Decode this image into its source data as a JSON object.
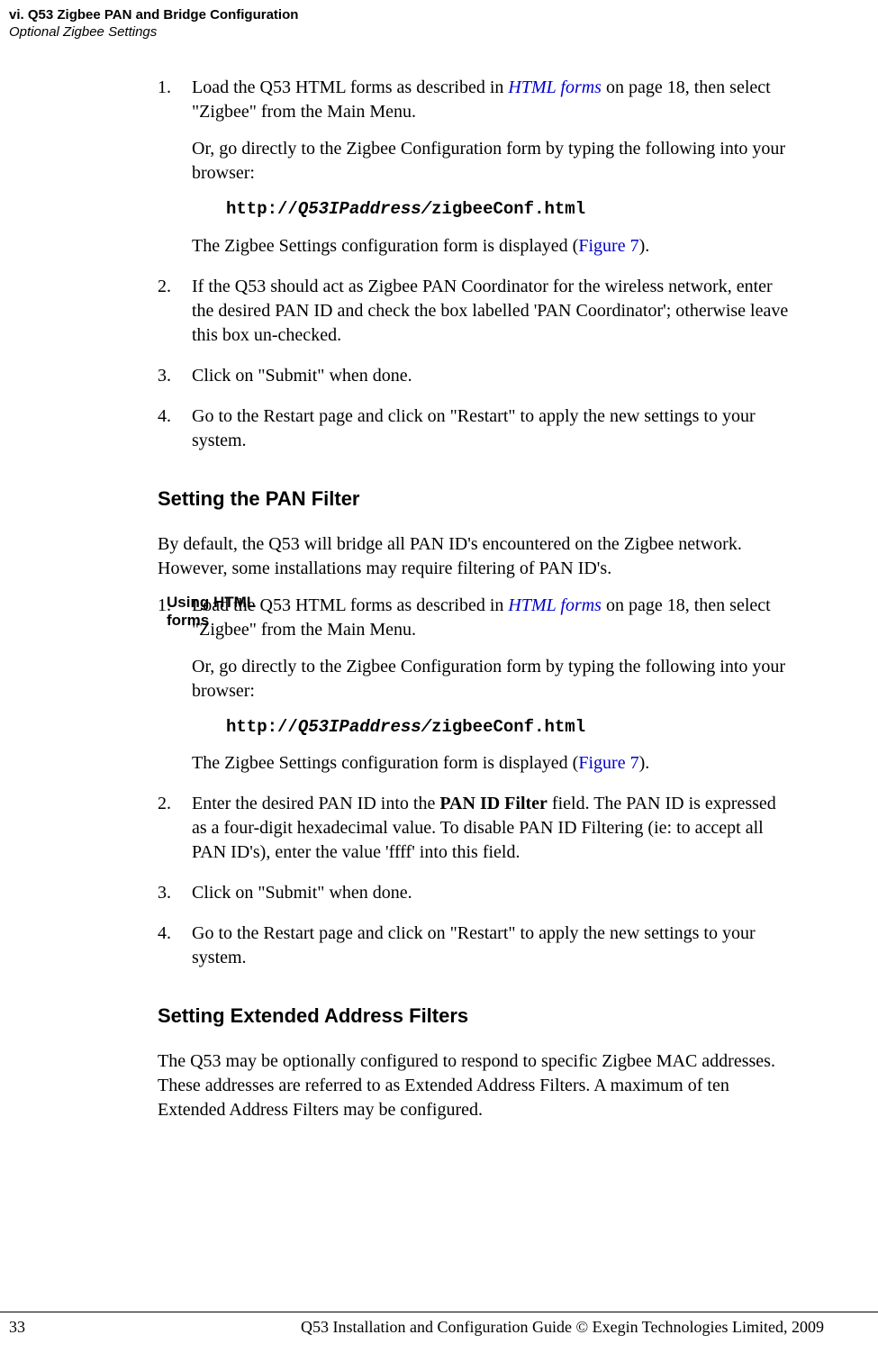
{
  "header": {
    "title": "vi. Q53 Zigbee PAN and Bridge Configuration",
    "subtitle": "Optional Zigbee Settings"
  },
  "block1": {
    "s1a": "Load the Q53 HTML forms as described in ",
    "s1link": "HTML forms",
    "s1b": " on page 18, then select \"Zigbee\" from the Main Menu.",
    "s1p2": "Or, go directly to the Zigbee Configuration form by typing the following into your browser:",
    "code_a": "http://",
    "code_b": "Q53IPaddress/",
    "code_c": "zigbeeConf.html",
    "s1p3a": "The Zigbee Settings configuration form is displayed (",
    "s1p3link": "Figure 7",
    "s1p3b": ").",
    "s2": "If the Q53 should act as Zigbee PAN Coordinator for the wireless network, enter the desired PAN ID and check the box labelled 'PAN Coordinator'; otherwise leave this box un-checked.",
    "s3": "Click on \"Submit\" when done.",
    "s4": "Go to the Restart page and click on \"Restart\" to apply the new settings to your system."
  },
  "section2": {
    "heading": "Setting the PAN Filter",
    "intro": "By default, the Q53 will bridge all PAN ID's encountered on the Zigbee network. However, some installations may require filtering of PAN ID's.",
    "margin_note": "Using HTML forms",
    "s1a": "Load the Q53 HTML forms as described in ",
    "s1link": "HTML forms",
    "s1b": " on page 18, then select \"Zigbee\" from the Main Menu.",
    "s1p2": "Or, go directly to the Zigbee Configuration form by typing the following into your browser:",
    "code_a": "http://",
    "code_b": "Q53IPaddress/",
    "code_c": "zigbeeConf.html",
    "s1p3a": "The Zigbee Settings configuration form is displayed (",
    "s1p3link": "Figure 7",
    "s1p3b": ").",
    "s2a": "Enter the desired PAN ID into the ",
    "s2bold": "PAN ID Filter",
    "s2b": " field. The PAN ID is expressed as a four-digit hexadecimal value. To disable PAN ID Filtering (ie: to accept all PAN ID's), enter the value 'ffff' into this field.",
    "s3": "Click on \"Submit\" when done.",
    "s4": "Go to the Restart page and click on \"Restart\" to apply the new settings to your system."
  },
  "section3": {
    "heading": "Setting Extended Address Filters",
    "intro": "The Q53 may be optionally configured to respond to specific Zigbee MAC addresses. These addresses are referred to as Extended Address Filters. A maximum of ten Extended Address Filters may be configured."
  },
  "footer": {
    "page": "33",
    "text": "Q53 Installation and Configuration Guide  © Exegin Technologies Limited, 2009"
  }
}
